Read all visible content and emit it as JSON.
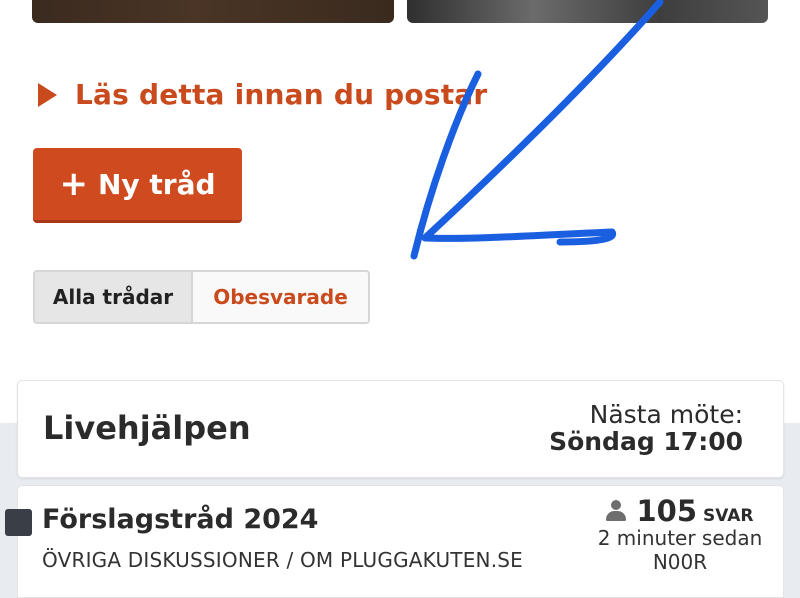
{
  "read_first_link": "Läs detta innan du postar",
  "new_thread_button": {
    "icon": "+",
    "label": "Ny tråd"
  },
  "filters": {
    "all": "Alla trådar",
    "unanswered": "Obesvarade",
    "active": "all"
  },
  "live_help": {
    "title": "Livehjälpen",
    "next_label": "Nästa möte:",
    "next_time": "Söndag 17:00"
  },
  "thread": {
    "title": "Förslagstråd 2024",
    "category": "ÖVRIGA DISKUSSIONER / OM PLUGGAKUTEN.SE",
    "replies": "105",
    "replies_label": "SVAR",
    "time_ago": "2 minuter sedan",
    "author": "N00R"
  },
  "colors": {
    "accent": "#c94a1c",
    "button": "#cf4a1e",
    "annotation": "#1a5fe0"
  },
  "icons": {
    "triangle": "caret-right-icon",
    "user": "user-icon",
    "status": "status-square-icon"
  }
}
